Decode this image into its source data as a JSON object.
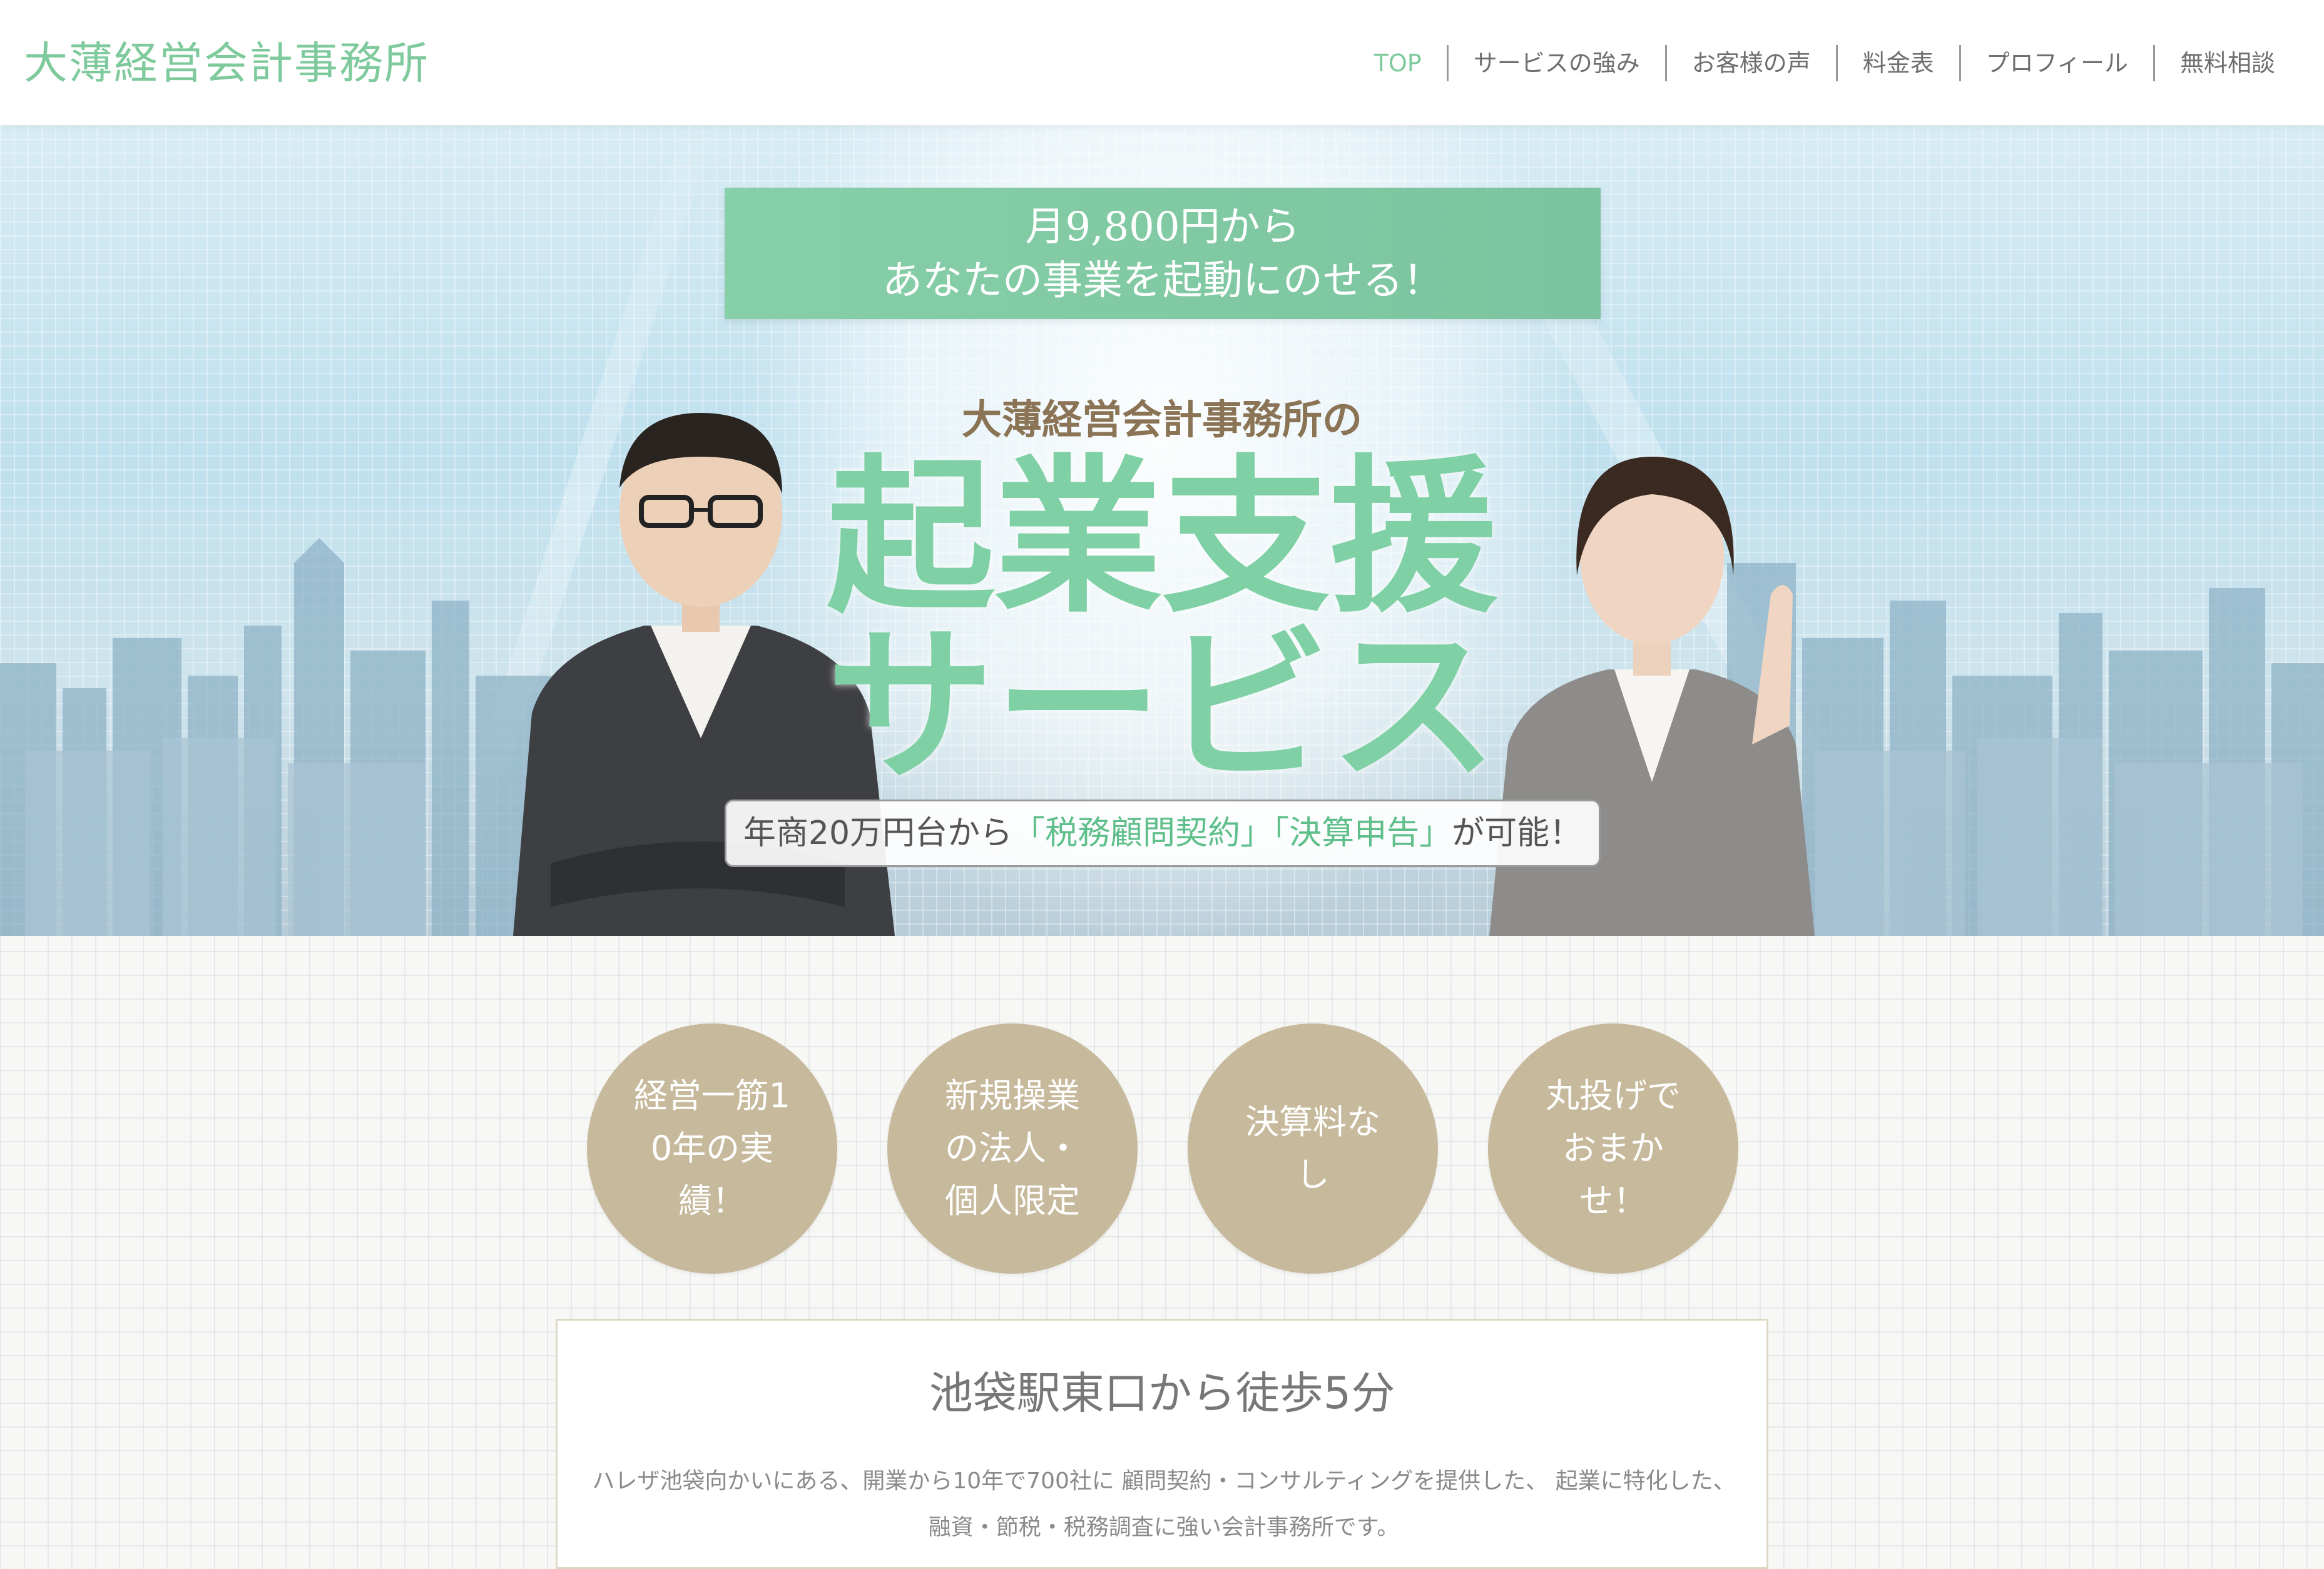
{
  "header": {
    "site_title": "大薄経営会計事務所",
    "nav": [
      {
        "label": "TOP",
        "active": true
      },
      {
        "label": "サービスの強み"
      },
      {
        "label": "お客様の声"
      },
      {
        "label": "料金表"
      },
      {
        "label": "プロフィール"
      },
      {
        "label": "無料相談"
      }
    ]
  },
  "hero": {
    "banner_line1": "月9,800円から",
    "banner_line2": "あなたの事業を起動にのせる！",
    "office_heading": "大薄経営会計事務所の",
    "service_line1": "起業支援",
    "service_line2": "サービス",
    "tagline": {
      "part1": "年商20万円台から",
      "highlight1": "「税務顧問契約」",
      "highlight2": "「決算申告」",
      "part2": "が可能！"
    }
  },
  "features": [
    {
      "text": "経営一筋10年の実績！"
    },
    {
      "text": "新規操業の法人・個人限定"
    },
    {
      "text": "決算料なし"
    },
    {
      "text": "丸投げでおまかせ！"
    }
  ],
  "info": {
    "title": "池袋駅東口から徒歩5分",
    "body_line1": "ハレザ池袋向かいにある、開業から10年で700社に 顧問契約・コンサルティングを提供した、 起業に特化した、",
    "body_line2": "融資・節税・税務調査に強い会計事務所です。"
  },
  "colors": {
    "accent_green": "#7fca9c",
    "circle_beige": "#c7b99c",
    "heading_brown": "#8a7455"
  }
}
